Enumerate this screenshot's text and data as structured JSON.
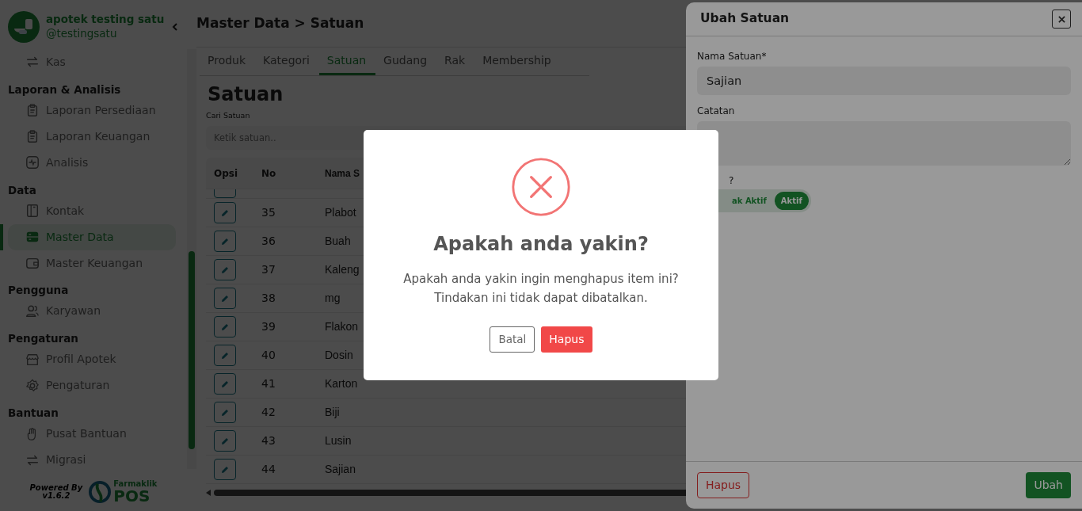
{
  "sidebar": {
    "brand": {
      "name": "apotek testing satu",
      "handle": "@testingsatu"
    },
    "sections": [
      {
        "items": [
          {
            "label": "Kas",
            "selected": false
          }
        ]
      },
      {
        "title": "Laporan & Analisis",
        "items": [
          {
            "label": "Laporan Persediaan",
            "selected": false
          },
          {
            "label": "Laporan Keuangan",
            "selected": false
          },
          {
            "label": "Analisis",
            "selected": false
          }
        ]
      },
      {
        "title": "Data",
        "items": [
          {
            "label": "Kontak",
            "selected": false
          },
          {
            "label": "Master Data",
            "selected": true
          },
          {
            "label": "Master Keuangan",
            "selected": false
          }
        ]
      },
      {
        "title": "Pengguna",
        "items": [
          {
            "label": "Karyawan",
            "selected": false
          }
        ]
      },
      {
        "title": "Pengaturan",
        "items": [
          {
            "label": "Profil Apotek",
            "selected": false
          },
          {
            "label": "Pengaturan",
            "selected": false
          }
        ]
      },
      {
        "title": "Bantuan",
        "items": [
          {
            "label": "Pusat Bantuan",
            "selected": false
          },
          {
            "label": "Migrasi",
            "selected": false
          }
        ]
      }
    ],
    "footer": {
      "powered_by": "Powered By",
      "version": "v1.6.2",
      "logo_top": "Farmaklik",
      "logo_bottom": "POS"
    }
  },
  "header": {
    "title": "Master Data > Satuan"
  },
  "tabs": [
    {
      "label": "Produk",
      "selected": false
    },
    {
      "label": "Kategori",
      "selected": false
    },
    {
      "label": "Satuan",
      "selected": true
    },
    {
      "label": "Gudang",
      "selected": false
    },
    {
      "label": "Rak",
      "selected": false
    },
    {
      "label": "Membership",
      "selected": false
    }
  ],
  "page": {
    "title": "Satuan",
    "search": {
      "label": "Cari Satuan",
      "placeholder": "Ketik satuan.."
    }
  },
  "table": {
    "columns": [
      "Opsi",
      "No",
      "Nama S"
    ],
    "rows": [
      {
        "no": "35",
        "name": "Plabot"
      },
      {
        "no": "36",
        "name": "Buah"
      },
      {
        "no": "37",
        "name": "Kaleng"
      },
      {
        "no": "38",
        "name": "mg"
      },
      {
        "no": "39",
        "name": "Flakon"
      },
      {
        "no": "40",
        "name": "Dosin"
      },
      {
        "no": "41",
        "name": "Karton"
      },
      {
        "no": "42",
        "name": "Biji"
      },
      {
        "no": "43",
        "name": "Lusin"
      },
      {
        "no": "44",
        "name": "Sajian"
      }
    ]
  },
  "drawer": {
    "title": "Ubah Satuan",
    "fields": [
      {
        "label": "Nama Satuan*",
        "value": "Sajian",
        "kind": "input"
      },
      {
        "label": "Catatan",
        "kind": "textarea"
      }
    ],
    "status": {
      "label": "?",
      "options": [
        {
          "label": "ak Aktif",
          "selected": false
        },
        {
          "label": "Aktif",
          "selected": true
        }
      ]
    },
    "buttons": [
      {
        "label": "Hapus",
        "kind": "danger"
      },
      {
        "label": "Ubah",
        "kind": "primary"
      }
    ]
  },
  "dialog": {
    "title": "Apakah anda yakin?",
    "message_lines": [
      "Apakah anda yakin ingin menghapus item ini?",
      "Tindakan ini tidak dapat dibatalkan."
    ],
    "buttons": [
      {
        "label": "Batal",
        "kind": "cancel"
      },
      {
        "label": "Hapus",
        "kind": "danger"
      }
    ]
  }
}
